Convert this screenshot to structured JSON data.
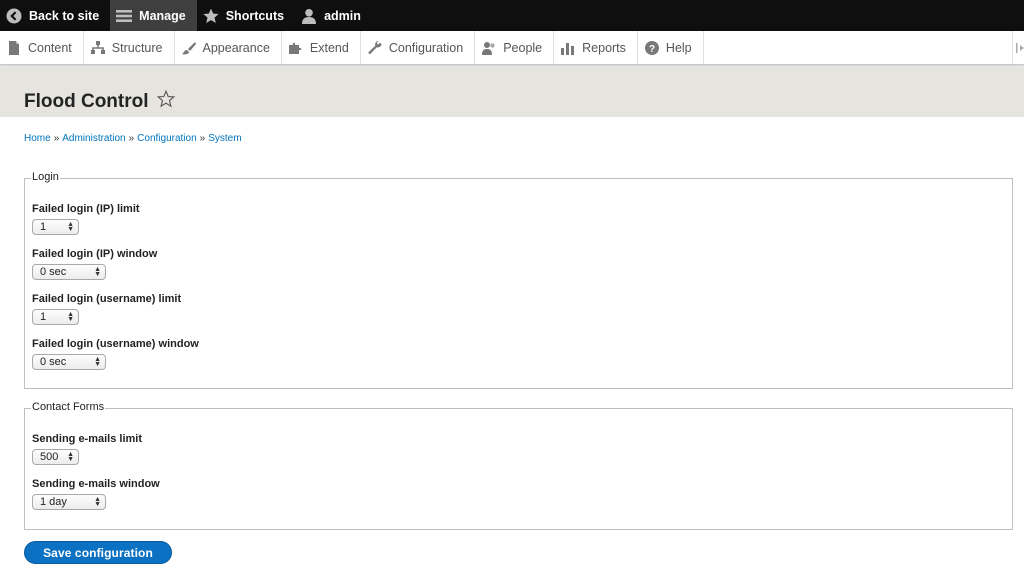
{
  "toolbar": {
    "back_label": "Back to site",
    "manage_label": "Manage",
    "shortcuts_label": "Shortcuts",
    "user_label": "admin"
  },
  "tray": {
    "items": [
      {
        "label": "Content",
        "icon": "file-icon"
      },
      {
        "label": "Structure",
        "icon": "sitemap-icon"
      },
      {
        "label": "Appearance",
        "icon": "paintbrush-icon"
      },
      {
        "label": "Extend",
        "icon": "puzzle-icon"
      },
      {
        "label": "Configuration",
        "icon": "wrench-icon"
      },
      {
        "label": "People",
        "icon": "people-icon"
      },
      {
        "label": "Reports",
        "icon": "bar-chart-icon"
      },
      {
        "label": "Help",
        "icon": "help-icon"
      }
    ]
  },
  "page": {
    "title": "Flood Control"
  },
  "breadcrumb": {
    "items": [
      "Home",
      "Administration",
      "Configuration",
      "System"
    ],
    "separator": "»"
  },
  "login": {
    "legend": "Login",
    "ip_limit_label": "Failed login (IP) limit",
    "ip_limit_value": "1",
    "ip_window_label": "Failed login (IP) window",
    "ip_window_value": "0 sec",
    "user_limit_label": "Failed login (username) limit",
    "user_limit_value": "1",
    "user_window_label": "Failed login (username) window",
    "user_window_value": "0 sec"
  },
  "contact": {
    "legend": "Contact Forms",
    "limit_label": "Sending e-mails limit",
    "limit_value": "500",
    "window_label": "Sending e-mails window",
    "window_value": "1 day"
  },
  "actions": {
    "save_label": "Save configuration"
  },
  "colors": {
    "toolbar_bg": "#0f0f0f",
    "link": "#0074bd",
    "button": "#0b71c3",
    "header_bg": "#e6e4df"
  }
}
